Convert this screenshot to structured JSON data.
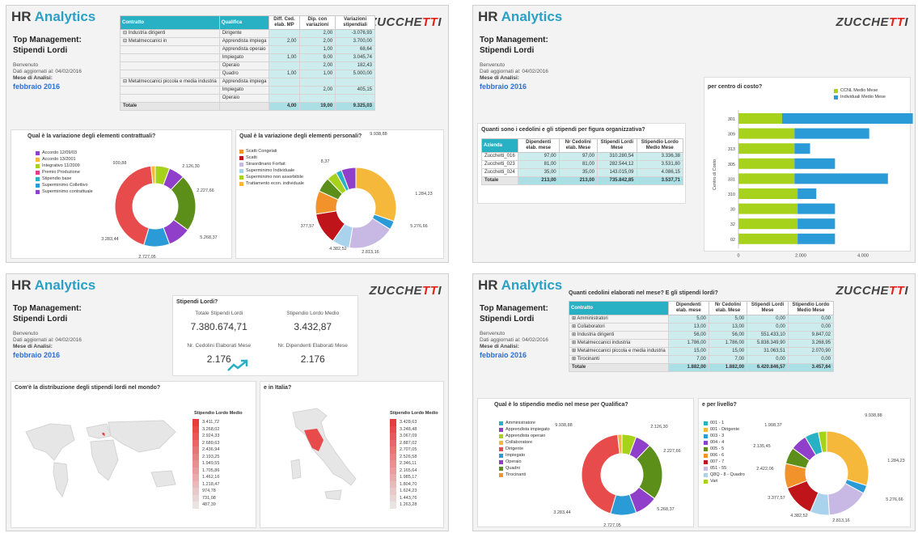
{
  "brand": {
    "a": "HR",
    "b": "Analytics"
  },
  "logo": {
    "word_a": "ZUCCHE",
    "word_b": "TT",
    "word_c": "I",
    "sub": "CONSULTING FOR ORGANIZATIONS"
  },
  "info": {
    "t1": "Top Management:",
    "t2": "Stipendi Lordi",
    "s1": "Benvenuto",
    "s2": "Dati aggiornati al: 04/02/2016",
    "s3": "Mese di Analisi:",
    "month": "febbraio 2016"
  },
  "p1": {
    "table": {
      "headers": [
        "Contratto",
        "Qualifica",
        "Diff. Ced. elab. MP",
        "Dip. con variazioni",
        "Variazioni stipendiali"
      ],
      "rows": [
        [
          "⊟ Industria dirigenti",
          "Dirigente",
          "",
          "2,00",
          "-3.076,93"
        ],
        [
          "⊟ Metalmeccanici in",
          "Apprendista impiega",
          "2,00",
          "2,00",
          "3.700,00"
        ],
        [
          "",
          "Apprendista operaio",
          "",
          "1,00",
          "68,64"
        ],
        [
          "",
          "Impiegato",
          "1,00",
          "9,00",
          "3.045,74"
        ],
        [
          "",
          "Operaio",
          "",
          "2,00",
          "182,43"
        ],
        [
          "",
          "Quadro",
          "1,00",
          "1,00",
          "5.000,00"
        ],
        [
          "⊟ Metalmeccanici piccola e media industria",
          "Apprendista impiega",
          "",
          "",
          ""
        ],
        [
          "",
          "Impiegato",
          "",
          "2,00",
          "405,15"
        ],
        [
          "",
          "Operaio",
          "",
          "",
          ""
        ]
      ],
      "total": [
        "Totale",
        "",
        "4,00",
        "19,00",
        "9.325,03"
      ]
    },
    "chart1": {
      "title": "Qual è la variazione degli elementi contrattuali?",
      "legend": [
        "Accordo 12/09/03",
        "Accordo 13/2001",
        "Integrativo 11/2009",
        "Premio Produzione",
        "Stipendio base",
        "Superminimo Collettivo",
        "Superminimo contrattuale"
      ],
      "labels": [
        "930,88",
        "2.126,30",
        "2.227,66",
        "5.268,37",
        "2.727,05",
        "3.283,44"
      ]
    },
    "chart2": {
      "title": "Qual è la variazione degli elementi personali?",
      "legend": [
        "Scatti Congelati",
        "Scatti",
        "Straordinario Forfait",
        "Superminimo Individuale",
        "Superminimo non assorbibile",
        "Trattamento econ. individuale"
      ],
      "labels": [
        "9.938,88",
        "8,37",
        "1.284,23",
        "5.276,66",
        "2.813,16",
        "4.382,52",
        "377,57"
      ]
    }
  },
  "p2": {
    "chart": {
      "title": "per centro di costo?",
      "ylabel": "Centro di Costo",
      "legend": [
        "CCNL Medio Mese",
        "Individuali Medio Mese"
      ],
      "categories": [
        "301",
        "309",
        "313",
        "305",
        "331",
        "310",
        "30",
        "32",
        "02"
      ],
      "xticks": [
        "0",
        "2.000",
        "4.000"
      ]
    },
    "table": {
      "title": "Quanti sono i cedolini e gli stipendi per figura organizzativa?",
      "headers": [
        "Azienda",
        "Dipendenti elab. mese",
        "Nr Cedolini elab. Mese",
        "Stipendi Lordi Mese",
        "Stipendio Lordo Medio Mese"
      ],
      "rows": [
        [
          "Zucchetti_016",
          "97,00",
          "97,00",
          "310.280,54",
          "3.336,38"
        ],
        [
          "Zucchetti_023",
          "81,00",
          "81,00",
          "282.544,12",
          "3.531,80"
        ],
        [
          "Zucchetti_024",
          "35,00",
          "35,00",
          "143.015,09",
          "4.086,15"
        ]
      ],
      "total": [
        "Totale",
        "213,00",
        "213,00",
        "735.842,85",
        "3.537,71"
      ]
    }
  },
  "p3": {
    "kpi": {
      "title": "Stipendi Lordi?",
      "l1": "Totale Stipendi Lordi",
      "v1": "7.380.674,71",
      "l2": "Stipendio Lordo Medio",
      "v2": "3.432,87",
      "l3": "Nr. Cedolini Elaborati Mese",
      "v3": "2.176",
      "l4": "Nr. Dipendenti Elaborati Mese",
      "v4": "2.176"
    },
    "world": {
      "title": "Com'è la distribuzione degli stipendi lordi nel mondo?",
      "legend_title": "Stipendio Lordo Medio",
      "values": [
        "3.411,72",
        "3.268,02",
        "2.924,33",
        "2.680,63",
        "2.436,94",
        "2.193,25",
        "1.949,55",
        "1.705,86",
        "1.462,16",
        "1.218,47",
        "974,78",
        "731,08",
        "487,39"
      ]
    },
    "italy": {
      "title": "e in Italia?",
      "legend_title": "Stipendio Lordo Medio",
      "values": [
        "3.428,63",
        "3.248,48",
        "3.067,09",
        "2.887,02",
        "2.707,05",
        "2.526,58",
        "2.346,11",
        "2.165,64",
        "1.985,17",
        "1.804,70",
        "1.624,23",
        "1.443,76",
        "1.263,28"
      ]
    }
  },
  "p4": {
    "table": {
      "title": "Quanti cedolini elaborati nel mese? E gli stipendi lordi?",
      "headers": [
        "Contratto",
        "Dipendenti elab. mese",
        "Nr Cedolini elab. Mese",
        "Stipendi Lordi Mese",
        "Stipendio Lordo Medio Mese"
      ],
      "rows": [
        [
          "⊞ Amministratori",
          "5,00",
          "5,00",
          "0,00",
          "0,00"
        ],
        [
          "⊞ Collaboratori",
          "13,00",
          "13,00",
          "0,00",
          "0,00"
        ],
        [
          "⊞ Industria dirigenti",
          "56,00",
          "56,00",
          "551.433,10",
          "9.847,02"
        ],
        [
          "⊞ Metalmeccanici industria",
          "1.786,00",
          "1.786,00",
          "5.838.349,90",
          "3.268,95"
        ],
        [
          "⊞ Metalmeccanici piccola e media industria",
          "15,00",
          "15,00",
          "31.063,51",
          "2.070,90"
        ],
        [
          "⊞ Tirocinanti",
          "7,00",
          "7,00",
          "0,00",
          "0,00"
        ]
      ],
      "total": [
        "Totale",
        "1.882,00",
        "1.882,00",
        "6.420.846,57",
        "3.457,64"
      ]
    },
    "chart1": {
      "title": "Qual è lo stipendio medio nel mese per Qualifica?",
      "legend": [
        "Amministratore",
        "Apprendista impiegato",
        "Apprendista operaio",
        "Collaboratore",
        "Dirigente",
        "Impiegato",
        "Operaio",
        "Quadro",
        "Tirocinanti"
      ],
      "labels": [
        "9.938,88",
        "2.126,30",
        "2.227,66",
        "5.268,37",
        "2.727,05",
        "3.283,44"
      ]
    },
    "chart2": {
      "title": "e per livello?",
      "legend": [
        "001 - 1",
        "001 - Dirigente",
        "003 - 3",
        "004 - 4",
        "005 - 5",
        "006 - 6",
        "007 - 7",
        "051 - 55",
        "Q8Q - 8 - Quadro",
        "Vari"
      ],
      "labels": [
        "9.938,88",
        "1.908,37",
        "2.135,45",
        "2.422,06",
        "1.284,23",
        "5.276,66",
        "2.813,16",
        "4.382,52",
        "3.377,57"
      ]
    }
  },
  "colors": {
    "red": "#e84b4b",
    "yellow": "#f6b83a",
    "green": "#5b8f1a",
    "lime": "#a6d21c",
    "purple": "#8f3fc9",
    "blue": "#2a9bd6",
    "teal": "#28b0c4",
    "orange": "#f2922a",
    "maroon": "#c0141b",
    "lavender": "#c8b8e4",
    "lightblue": "#a9d3ec",
    "pink": "#e83a8b"
  }
}
